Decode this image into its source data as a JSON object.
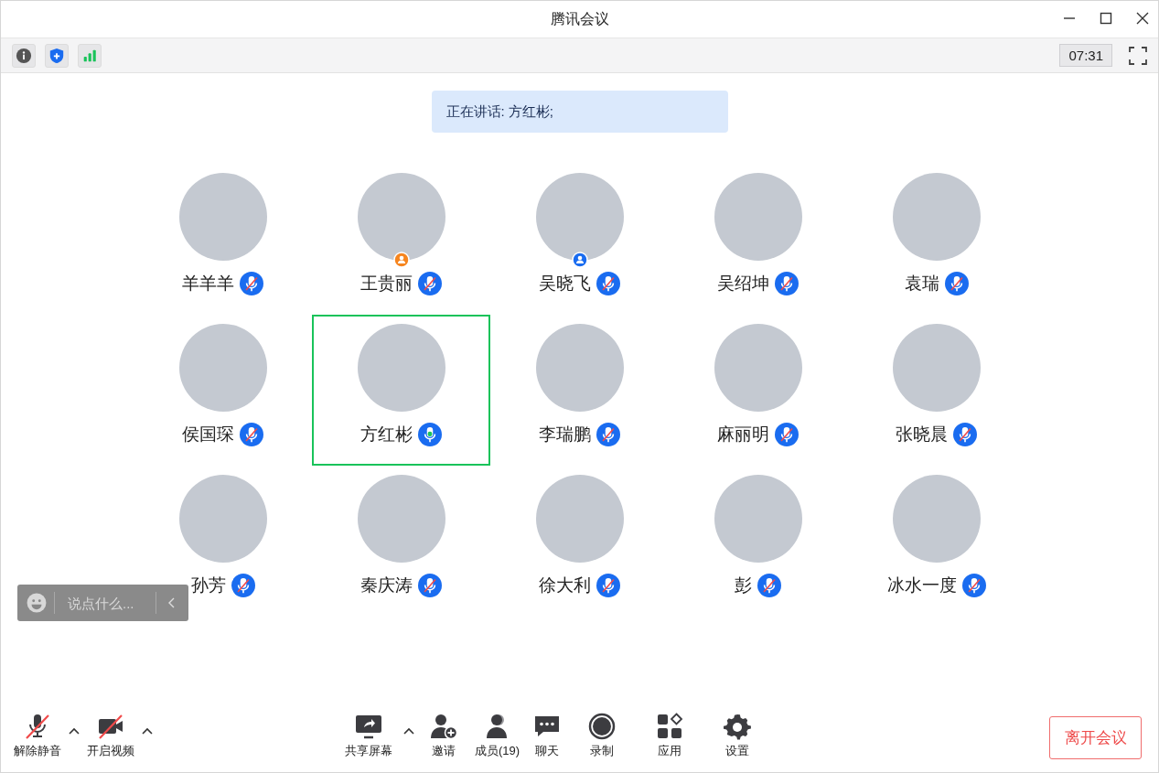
{
  "window": {
    "title": "腾讯会议"
  },
  "info_bar": {
    "timer": "07:31"
  },
  "speaking_banner": "正在讲话: 方红彬;",
  "participants": [
    {
      "name": "羊羊羊",
      "kind": "member",
      "muted": true,
      "speaking": false
    },
    {
      "name": "王贵丽",
      "kind": "host",
      "muted": true,
      "speaking": false
    },
    {
      "name": "吴晓飞",
      "kind": "cohost",
      "muted": true,
      "speaking": false
    },
    {
      "name": "吴绍坤",
      "kind": "member",
      "muted": true,
      "speaking": false
    },
    {
      "name": "袁瑞",
      "kind": "member",
      "muted": true,
      "speaking": false
    },
    {
      "name": "侯国琛",
      "kind": "member",
      "muted": true,
      "speaking": false
    },
    {
      "name": "方红彬",
      "kind": "member",
      "muted": false,
      "speaking": true
    },
    {
      "name": "李瑞鹏",
      "kind": "member",
      "muted": true,
      "speaking": false
    },
    {
      "name": "麻丽明",
      "kind": "member",
      "muted": true,
      "speaking": false
    },
    {
      "name": "张晓晨",
      "kind": "member",
      "muted": true,
      "speaking": false
    },
    {
      "name": "孙芳",
      "kind": "member",
      "muted": true,
      "speaking": false
    },
    {
      "name": "秦庆涛",
      "kind": "member",
      "muted": true,
      "speaking": false
    },
    {
      "name": "徐大利",
      "kind": "member",
      "muted": true,
      "speaking": false
    },
    {
      "name": "彭",
      "kind": "member",
      "muted": true,
      "speaking": false
    },
    {
      "name": "冰水一度",
      "kind": "member",
      "muted": true,
      "speaking": false
    }
  ],
  "chat_input": {
    "placeholder": "说点什么..."
  },
  "controls": [
    {
      "kind": "mic",
      "label": "解除静音",
      "off": true,
      "has_menu": true
    },
    {
      "kind": "video",
      "label": "开启视频",
      "off": true,
      "has_menu": true
    },
    {
      "kind": "share",
      "label": "共享屏幕",
      "off": false,
      "has_menu": true
    },
    {
      "kind": "invite",
      "label": "邀请",
      "off": false,
      "has_menu": false
    },
    {
      "kind": "members",
      "label": "成员(19)",
      "off": false,
      "has_menu": false
    },
    {
      "kind": "chat",
      "label": "聊天",
      "off": false,
      "has_menu": false
    },
    {
      "kind": "record",
      "label": "录制",
      "off": false,
      "has_menu": false
    },
    {
      "kind": "apps",
      "label": "应用",
      "off": false,
      "has_menu": false
    },
    {
      "kind": "settings",
      "label": "设置",
      "off": false,
      "has_menu": false
    }
  ],
  "leave_button": "离开会议"
}
